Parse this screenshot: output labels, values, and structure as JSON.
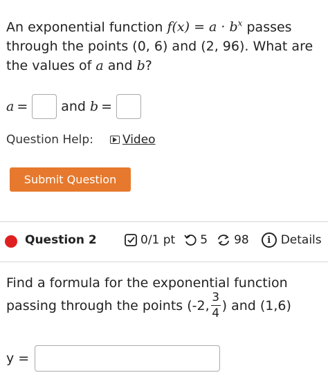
{
  "question1": {
    "prompt_part1": "An exponential function ",
    "function_math": "f(x) = a · b",
    "function_exp": "x",
    "prompt_part2": " passes through the points (0, 6) and (2, 96). What are the values of ",
    "var_a": "a",
    "prompt_and": " and ",
    "var_b": "b",
    "prompt_end": "?",
    "answer_a_label": "a",
    "equals": "=",
    "answer_and": "and",
    "answer_b_label": "b",
    "help_label": "Question Help:",
    "video_label": "Video",
    "submit_label": "Submit Question"
  },
  "question2": {
    "title": "Question 2",
    "score": "0/1 pt",
    "attempts": "5",
    "count": "98",
    "details_label": "Details",
    "prompt_line1": "Find a formula for the exponential function",
    "prompt_line2_a": "passing through the points (-2,",
    "frac_num": "3",
    "frac_den": "4",
    "prompt_line2_b": ") and (1,6)",
    "y_label": "y =",
    "y_value": ""
  },
  "colors": {
    "submit_bg": "#e6792d",
    "status_dot": "#e02020",
    "divider": "#d6d6d6"
  },
  "icons": [
    "play-icon",
    "checkbox-icon",
    "retry-icon",
    "refresh-icon",
    "info-icon"
  ]
}
